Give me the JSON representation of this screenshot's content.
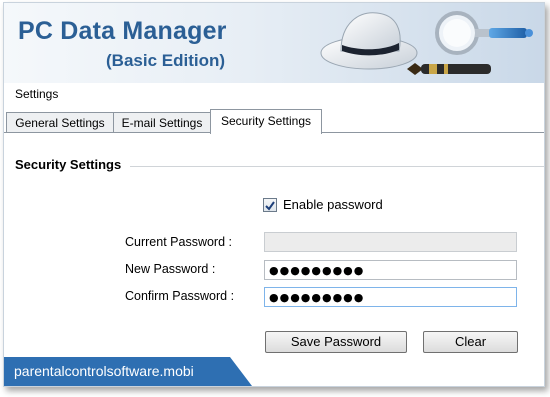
{
  "header": {
    "title": "PC Data Manager",
    "edition": "(Basic Edition)"
  },
  "settings_label": "Settings",
  "tabs": [
    {
      "label": "General Settings",
      "active": false
    },
    {
      "label": "E-mail Settings",
      "active": false
    },
    {
      "label": "Security Settings",
      "active": true
    }
  ],
  "security": {
    "section_title": "Security Settings",
    "enable_password_label": "Enable password",
    "enable_password_checked": true,
    "current_password_label": "Current Password :",
    "current_password_value": "",
    "new_password_label": "New Password :",
    "new_password_value": "●●●●●●●●●",
    "confirm_password_label": "Confirm Password :",
    "confirm_password_value": "●●●●●●●●●",
    "save_button": "Save Password",
    "clear_button": "Clear"
  },
  "footer": {
    "website": "parentalcontrolsoftware.mobi"
  },
  "colors": {
    "brand_text": "#2b5f95",
    "footer_badge": "#2e6fb2",
    "focus_border": "#7eb4ea"
  },
  "icons": [
    "hat-icon",
    "magnifier-icon",
    "pen-icon",
    "checkmark-icon"
  ]
}
